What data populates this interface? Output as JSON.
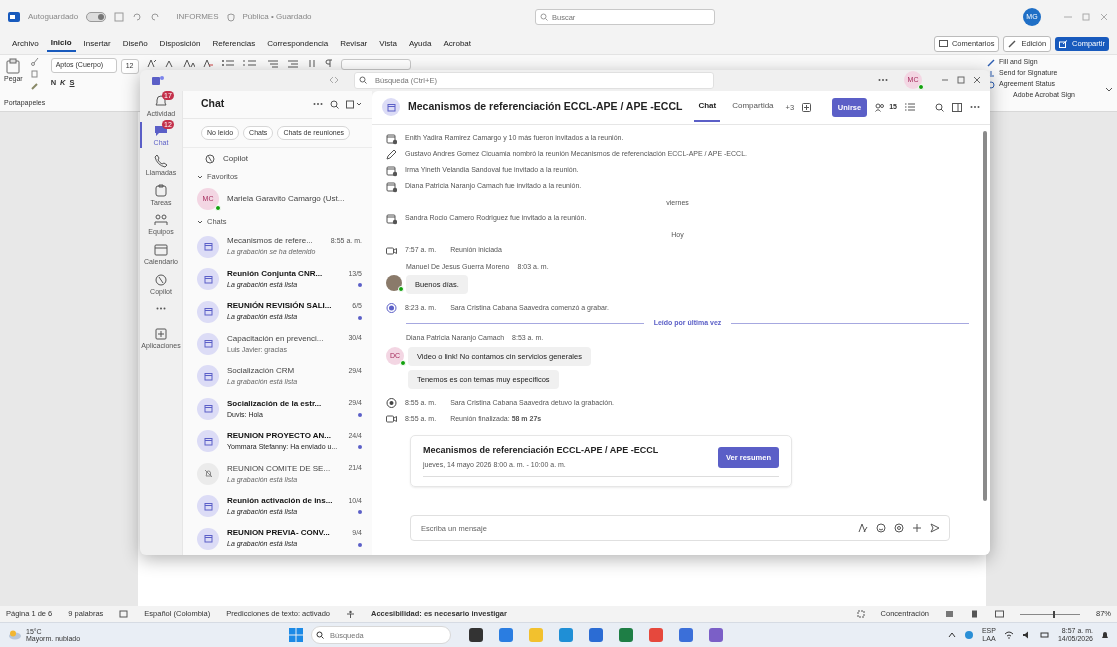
{
  "word": {
    "title_bar": {
      "autosave_label": "Autoguardado",
      "autosave_on": true,
      "doc_name": "INFORMES",
      "doc_status": "Pública • Guardado",
      "search_placeholder": "Buscar",
      "avatar": "MG"
    },
    "menu": [
      {
        "label": "Archivo",
        "selected": false
      },
      {
        "label": "Inicio",
        "selected": true
      },
      {
        "label": "Insertar",
        "selected": false
      },
      {
        "label": "Diseño",
        "selected": false
      },
      {
        "label": "Disposición",
        "selected": false
      },
      {
        "label": "Referencias",
        "selected": false
      },
      {
        "label": "Correspondencia",
        "selected": false
      },
      {
        "label": "Revisar",
        "selected": false
      },
      {
        "label": "Vista",
        "selected": false
      },
      {
        "label": "Ayuda",
        "selected": false
      },
      {
        "label": "Acrobat",
        "selected": false
      }
    ],
    "menu_actions": [
      "Comentarios",
      "Edición",
      "Compartir"
    ],
    "ribbon": {
      "paste": "Pegar",
      "font": "Aptos (Cuerpo)",
      "size": "12",
      "format_buttons": [
        "N",
        "K",
        "S"
      ],
      "group": "Portapapeles",
      "acrobat": [
        "Fill and Sign",
        "Send for Signature",
        "Agreement Status"
      ],
      "acrobat_group": "Adobe Acrobat Sign"
    },
    "status_bar": {
      "items": [
        "Página 1 de 6",
        "9 palabras",
        "Español (Colombia)",
        "Predicciones de texto: activado",
        "Accesibilidad: es necesario investigar"
      ],
      "focus": "Concentración",
      "zoom": {
        "level": 0.55,
        "reading": "87%"
      }
    }
  },
  "teams": {
    "top_bar": {
      "search_placeholder": "Búsqueda (Ctrl+E)",
      "avatar": "MC"
    },
    "rail": [
      {
        "kind": "activity",
        "label": "Actividad",
        "badge": "17",
        "selected": false
      },
      {
        "kind": "chat",
        "label": "Chat",
        "badge": "12",
        "selected": true
      },
      {
        "kind": "calls",
        "label": "Llamadas",
        "selected": false
      },
      {
        "kind": "tasks",
        "label": "Tareas",
        "selected": false
      },
      {
        "kind": "teams",
        "label": "Equipos",
        "selected": false
      },
      {
        "kind": "calendar",
        "label": "Calendario",
        "selected": false
      },
      {
        "kind": "copilot",
        "label": "Copilot",
        "selected": false
      },
      {
        "kind": "more",
        "selected": false
      },
      {
        "kind": "apps",
        "label": "Aplicaciones",
        "selected": false
      }
    ],
    "chat_list": {
      "title": "Chat",
      "filters": [
        "No leído",
        "Chats",
        "Chats de reuniones"
      ],
      "copilot": "Copilot",
      "sections": [
        {
          "label": "Favoritos",
          "expanded": true,
          "items": [
            {
              "kind": "person",
              "initials": "MC",
              "name": "Mariela Garavito Camargo (Ust...",
              "online": true
            }
          ]
        },
        {
          "label": "Chats",
          "expanded": true,
          "items": [
            {
              "kind": "meeting",
              "name": "Mecanismos de refere...",
              "time": "8:55 a. m.",
              "preview": "La grabación se ha detenido",
              "system": true,
              "unread": false
            },
            {
              "kind": "meeting",
              "name": "Reunión Conjunta CNR...",
              "time": "13/5",
              "preview": "La grabación está lista",
              "system": true,
              "unread": true
            },
            {
              "kind": "meeting",
              "name": "REUNIÓN REVISIÓN SALI...",
              "time": "6/5",
              "preview": "La grabación está lista",
              "system": true,
              "unread": true
            },
            {
              "kind": "meeting",
              "name": "Capacitación en prevenci...",
              "time": "30/4",
              "preview": "Luis Javier: gracias",
              "system": false,
              "unread": false
            },
            {
              "kind": "meeting",
              "name": "Socialización CRM",
              "time": "29/4",
              "preview": "La grabación está lista",
              "system": true,
              "unread": false
            },
            {
              "kind": "meeting",
              "name": "Socialización de la estr...",
              "time": "29/4",
              "preview": "Duvis: Hola",
              "system": false,
              "unread": true
            },
            {
              "kind": "meeting",
              "name": "REUNION PROYECTO AN...",
              "time": "24/4",
              "preview": "Yommara Stefanny: Ha enviado u...",
              "system": false,
              "unread": true
            },
            {
              "kind": "muted",
              "name": "REUNION COMITE DE SE...",
              "time": "21/4",
              "preview": "La grabación está lista",
              "system": true,
              "unread": false
            },
            {
              "kind": "meeting",
              "name": "Reunión activación de ins...",
              "time": "10/4",
              "preview": "La grabación está lista",
              "system": true,
              "unread": true
            },
            {
              "kind": "meeting",
              "name": "REUNION PREVIA- CONV...",
              "time": "9/4",
              "preview": "La grabación está lista",
              "system": true,
              "unread": true
            }
          ]
        }
      ]
    },
    "conversation": {
      "title": "Mecanismos de referenciación ECCL-APE / APE -ECCL",
      "tabs": [
        {
          "label": "Chat",
          "selected": true
        },
        {
          "label": "Compartida",
          "selected": false
        }
      ],
      "more_tabs": "+3",
      "join": "Unirse",
      "participants": "15",
      "messages": [
        {
          "kind": "invite",
          "text": "Enith Yadira Ramirez Camargo y 10 más fueron invitados a la reunión."
        },
        {
          "kind": "rename",
          "text": "Gustavo Andres Gomez Cicuamia nombró la reunión Mecanismos de referenciación ECCL-APE / APE -ECCL."
        },
        {
          "kind": "invite",
          "text": "Irma Yineth Velandia Sandoval fue invitado a la reunión."
        },
        {
          "kind": "invite",
          "text": "Diana Patricia Naranjo Camach fue invitado a la reunión."
        },
        {
          "kind": "day",
          "text": "viernes"
        },
        {
          "kind": "invite",
          "text": "Sandra Rocio Camero Rodriguez fue invitado a la reunión."
        },
        {
          "kind": "day",
          "text": "Hoy"
        },
        {
          "kind": "meeting",
          "time": "7:57 a. m.",
          "text": "Reunión iniciada"
        },
        {
          "kind": "message",
          "author": "Manuel De Jesus Guerra Moreno",
          "time": "8:03 a. m.",
          "online": true,
          "bubbles": [
            "Buenos días."
          ]
        },
        {
          "kind": "record-start",
          "time": "8:23 a. m.",
          "text": "Sara Cristina Cabana Saavedra comenzó a grabar."
        },
        {
          "kind": "read-marker",
          "text": "Leído por última vez"
        },
        {
          "kind": "message",
          "author": "Diana Patricia Naranjo Camach",
          "time": "8:53 a. m.",
          "avatar": "DC",
          "online": true,
          "bubbles": [
            "Video o link! No contamos cin servicios generales",
            "Tenemos es con temas muy especificos"
          ]
        },
        {
          "kind": "record-stop",
          "time": "8:55 a. m.",
          "text": "Sara Cristina Cabana Saavedra detuvo la grabación."
        },
        {
          "kind": "meeting",
          "time": "8:55 a. m.",
          "text": "Reunión finalizada: **58 m 27s**"
        },
        {
          "kind": "card",
          "title": "Mecanismos de referenciación ECCL-APE / APE -ECCL",
          "subtitle": "jueves, 14 mayo 2026 8:00 a. m. - 10:00 a. m.",
          "button": "Ver resumen"
        }
      ],
      "compose_placeholder": "Escriba un mensaje"
    }
  },
  "taskbar": {
    "weather": {
      "temp": "15°C",
      "desc": "Mayorm. nublado"
    },
    "search_placeholder": "Búsqueda",
    "lang": [
      "ESP",
      "LAA"
    ],
    "time": "8:57 a. m.",
    "date": "14/05/2026"
  }
}
